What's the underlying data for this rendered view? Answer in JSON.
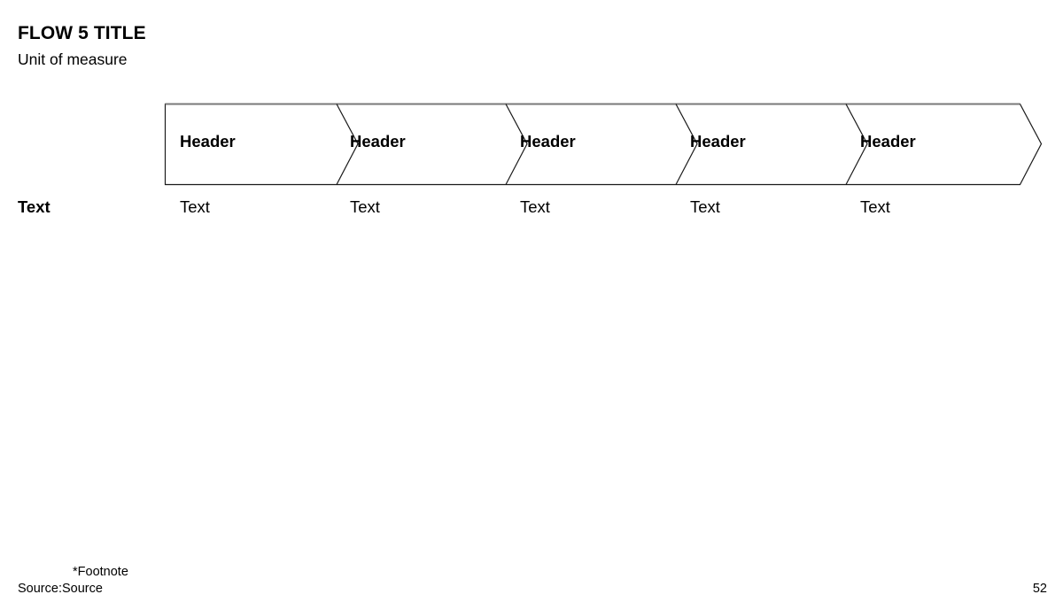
{
  "slide": {
    "title": "FLOW 5 TITLE",
    "subtitle": "Unit of measure",
    "page_number": "52"
  },
  "flow": {
    "row_label": "Text",
    "stages": [
      {
        "header": "Header",
        "text": "Text"
      },
      {
        "header": "Header",
        "text": "Text"
      },
      {
        "header": "Header",
        "text": "Text"
      },
      {
        "header": "Header",
        "text": "Text"
      },
      {
        "header": "Header",
        "text": "Text"
      }
    ],
    "style": {
      "fill": "#ffffff",
      "outline_top": "#787878",
      "outline": "#1a1a1a",
      "divider": "#1a1a1a"
    }
  },
  "footer": {
    "footnote": "*Footnote",
    "source": "Source:Source"
  }
}
